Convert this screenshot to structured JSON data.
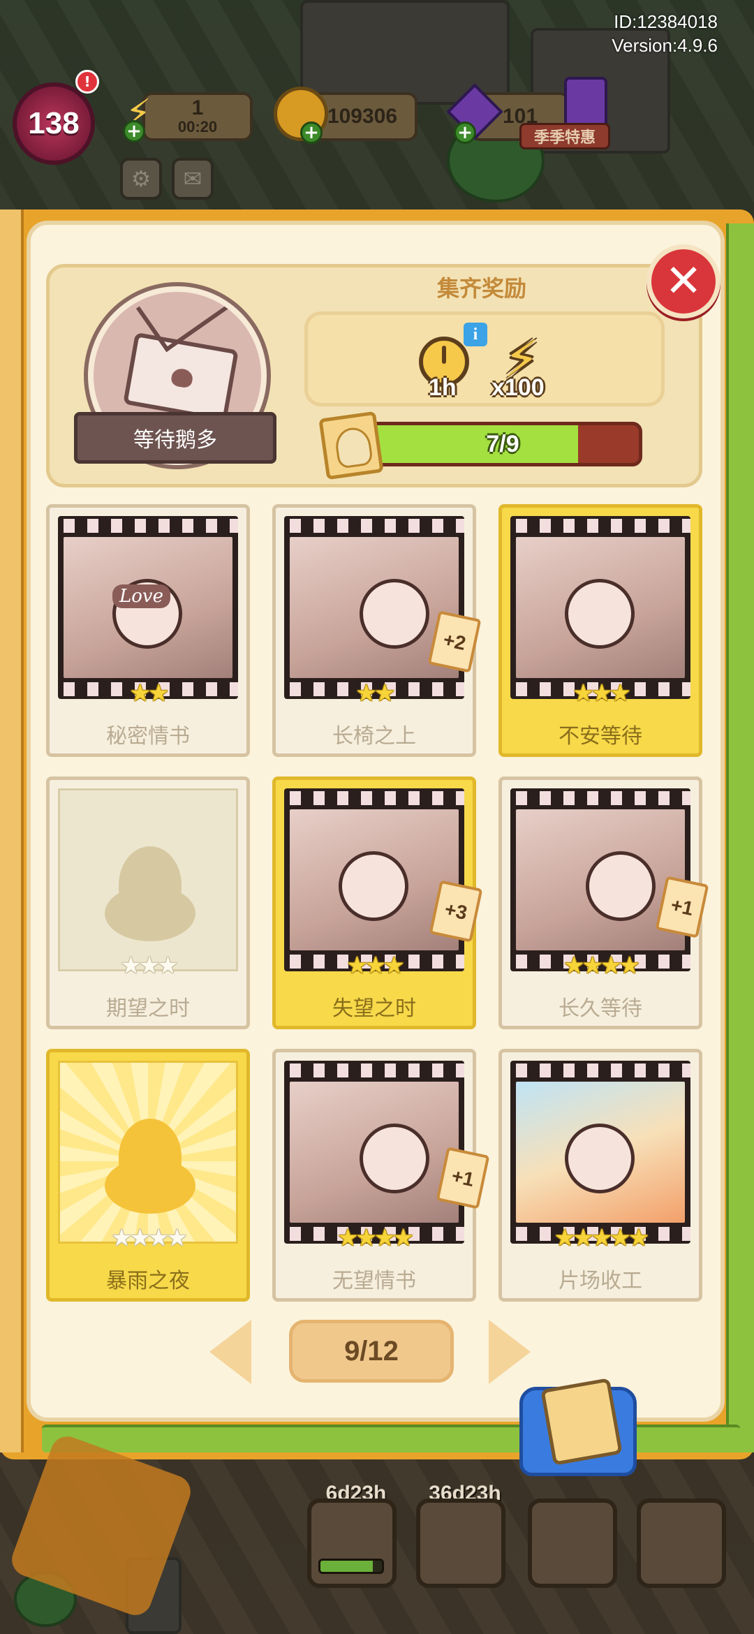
{
  "meta": {
    "id_text": "ID:12384018",
    "version_text": "Version:4.9.6"
  },
  "hud": {
    "level": "138",
    "level_alert": "!",
    "energy": {
      "value": "1",
      "timer": "00:20",
      "icon": "lightning-bolt-icon"
    },
    "coins": {
      "value": "109306",
      "icon": "gold-coin-icon"
    },
    "gems": {
      "value": "101",
      "icon": "purple-gem-icon"
    },
    "sale_banner": "季季特惠",
    "settings_icon": "gear-icon",
    "mail_icon": "mail-icon"
  },
  "album": {
    "name": "等待鹅多",
    "cover_icon": "love-letter-icon",
    "reward": {
      "title": "集齐奖励",
      "duration": "1h",
      "amount": "x100",
      "icons": [
        "stopwatch-icon",
        "lightning-bolt-icon"
      ]
    },
    "progress": {
      "collected": 7,
      "total": 9,
      "label": "7/9"
    }
  },
  "cards": [
    {
      "title": "秘密情书",
      "stars": 2,
      "max_stars": 2,
      "state": "owned",
      "gold": false,
      "dup": "",
      "art_text": "Love"
    },
    {
      "title": "长椅之上",
      "stars": 2,
      "max_stars": 2,
      "state": "owned",
      "gold": false,
      "dup": "+2"
    },
    {
      "title": "不安等待",
      "stars": 3,
      "max_stars": 3,
      "state": "owned",
      "gold": true,
      "dup": ""
    },
    {
      "title": "期望之时",
      "stars": 0,
      "max_stars": 3,
      "state": "locked",
      "gold": false,
      "dup": ""
    },
    {
      "title": "失望之时",
      "stars": 3,
      "max_stars": 3,
      "state": "owned",
      "gold": true,
      "dup": "+3"
    },
    {
      "title": "长久等待",
      "stars": 4,
      "max_stars": 4,
      "state": "owned",
      "gold": false,
      "dup": "+1"
    },
    {
      "title": "暴雨之夜",
      "stars": 0,
      "max_stars": 4,
      "state": "locked",
      "gold": true,
      "dup": ""
    },
    {
      "title": "无望情书",
      "stars": 4,
      "max_stars": 4,
      "state": "owned",
      "gold": false,
      "dup": "+1"
    },
    {
      "title": "片场收工",
      "stars": 5,
      "max_stars": 5,
      "state": "owned",
      "gold": false,
      "dup": "",
      "color": true
    }
  ],
  "pager": {
    "label": "9/12",
    "prev_icon": "chevron-left-icon",
    "next_icon": "chevron-right-icon"
  },
  "dock": {
    "timer1": "6d23h",
    "timer2": "36d23h",
    "event_progress": 0.85,
    "icons": [
      "pillar-event-icon",
      "card-album-icon",
      "help-flower-icon",
      "friends-chat-icon"
    ]
  },
  "colors": {
    "panel_bg": "#fbf3dc",
    "accent_gold": "#f7d94a",
    "progress_fill": "#a4e040",
    "close_red": "#d9363b"
  }
}
